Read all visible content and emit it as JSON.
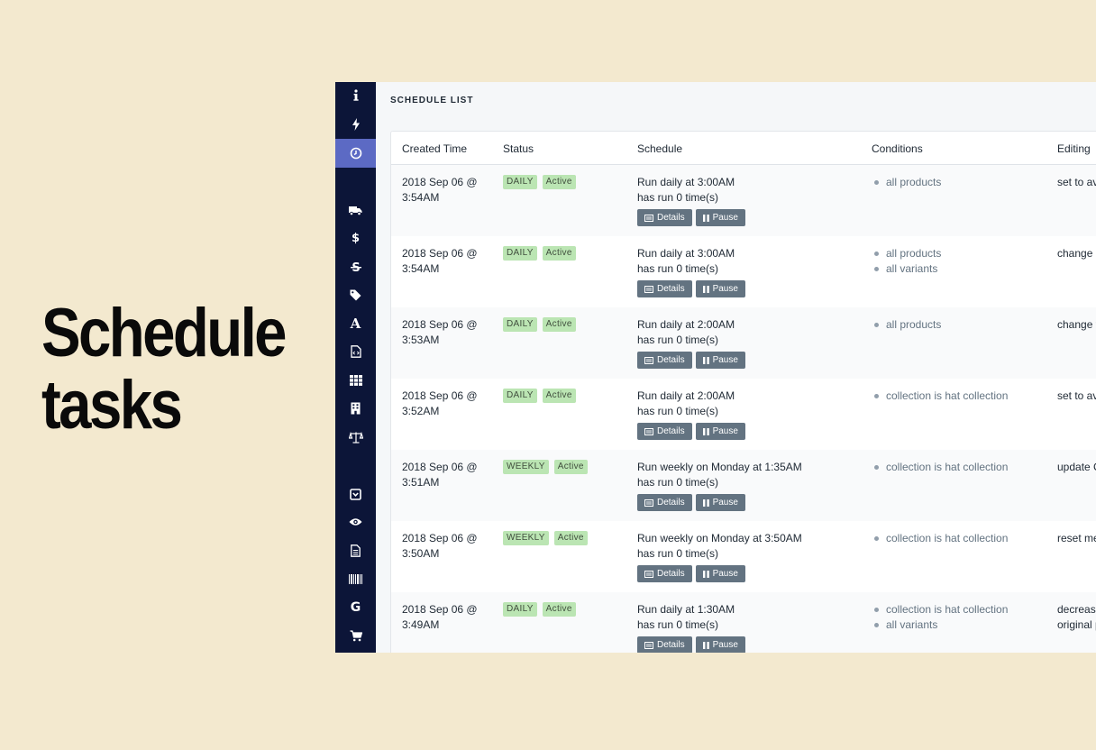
{
  "hero": {
    "line1": "Schedule",
    "line2": "tasks"
  },
  "colors": {
    "page_bg": "#f3e9cf",
    "sidebar_bg": "#0c1538",
    "sidebar_active": "#5c6ac4",
    "badge_green": "#bbe5b3",
    "button_slate": "#637381"
  },
  "sidebar": {
    "icons": [
      "info-icon",
      "lightning-icon",
      "clock-icon",
      "truck-icon",
      "dollar-icon",
      "strikethrough-icon",
      "tag-icon",
      "font-icon",
      "file-code-icon",
      "grid-icon",
      "building-icon",
      "scale-icon",
      "archive-icon",
      "eye-icon",
      "document-icon",
      "barcode-icon",
      "google-icon",
      "cart-icon"
    ],
    "active": "clock-icon"
  },
  "main": {
    "title": "SCHEDULE LIST",
    "columns": [
      "Created Time",
      "Status",
      "Schedule",
      "Conditions",
      "Editing"
    ],
    "details_label": "Details",
    "pause_label": "Pause",
    "rows": [
      {
        "created": "2018 Sep 06 @ 3:54AM",
        "freq": "DAILY",
        "state": "Active",
        "schedule": "Run daily at 3:00AM",
        "runs": "has run 0 time(s)",
        "conditions": [
          "all products"
        ],
        "editing": [
          "set to av"
        ]
      },
      {
        "created": "2018 Sep 06 @ 3:54AM",
        "freq": "DAILY",
        "state": "Active",
        "schedule": "Run daily at 3:00AM",
        "runs": "has run 0 time(s)",
        "conditions": [
          "all products",
          "all variants"
        ],
        "editing": [
          "change r"
        ]
      },
      {
        "created": "2018 Sep 06 @ 3:53AM",
        "freq": "DAILY",
        "state": "Active",
        "schedule": "Run daily at 2:00AM",
        "runs": "has run 0 time(s)",
        "conditions": [
          "all products"
        ],
        "editing": [
          "change t"
        ]
      },
      {
        "created": "2018 Sep 06 @ 3:52AM",
        "freq": "DAILY",
        "state": "Active",
        "schedule": "Run daily at 2:00AM",
        "runs": "has run 0 time(s)",
        "conditions": [
          "collection is hat collection"
        ],
        "editing": [
          "set to av"
        ]
      },
      {
        "created": "2018 Sep 06 @ 3:51AM",
        "freq": "WEEKLY",
        "state": "Active",
        "schedule": "Run weekly on Monday at 1:35AM",
        "runs": "has run 0 time(s)",
        "conditions": [
          "collection is hat collection"
        ],
        "editing": [
          "update C"
        ]
      },
      {
        "created": "2018 Sep 06 @ 3:50AM",
        "freq": "WEEKLY",
        "state": "Active",
        "schedule": "Run weekly on Monday at 3:50AM",
        "runs": "has run 0 time(s)",
        "conditions": [
          "collection is hat collection"
        ],
        "editing": [
          "reset me"
        ]
      },
      {
        "created": "2018 Sep 06 @ 3:49AM",
        "freq": "DAILY",
        "state": "Active",
        "schedule": "Run daily at 1:30AM",
        "runs": "has run 0 time(s)",
        "conditions": [
          "collection is hat collection",
          "all variants"
        ],
        "editing": [
          "decrease",
          "original p"
        ]
      }
    ]
  }
}
